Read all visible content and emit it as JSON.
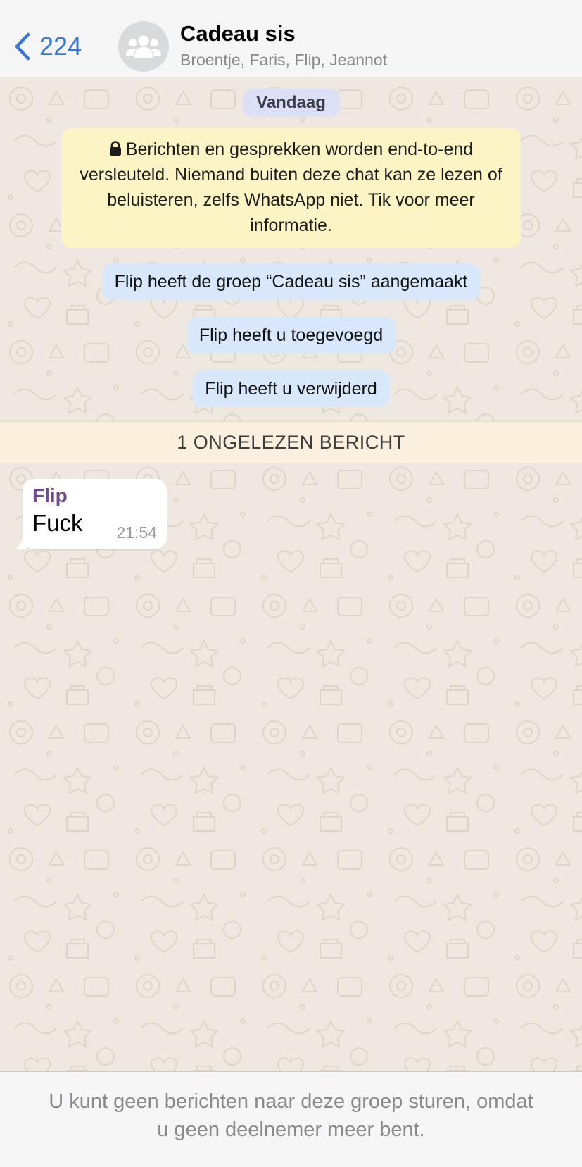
{
  "header": {
    "back_count": "224",
    "title": "Cadeau sis",
    "subtitle": "Broentje, Faris, Flip, Jeannot",
    "accent_color": "#3477d8"
  },
  "chat": {
    "date_label": "Vandaag",
    "encryption_notice": "Berichten en gesprekken worden end-to-end versleuteld. Niemand buiten deze chat kan ze lezen of beluisteren, zelfs WhatsApp niet. Tik voor meer informatie.",
    "system_messages": [
      "Flip heeft de groep “Cadeau sis” aangemaakt",
      "Flip heeft u toegevoegd",
      "Flip heeft u verwijderd"
    ],
    "unread_label": "1 ONGELEZEN BERICHT",
    "messages": [
      {
        "sender": "Flip",
        "text": "Fuck",
        "time": "21:54",
        "sender_color": "#6e4a8c"
      }
    ]
  },
  "footer": {
    "line1": "U kunt geen berichten naar deze groep sturen, omdat",
    "line2": "u geen deelnemer meer bent."
  },
  "icons": {
    "back": "chevron-left-icon",
    "avatar": "group-icon",
    "lock": "lock-icon"
  }
}
